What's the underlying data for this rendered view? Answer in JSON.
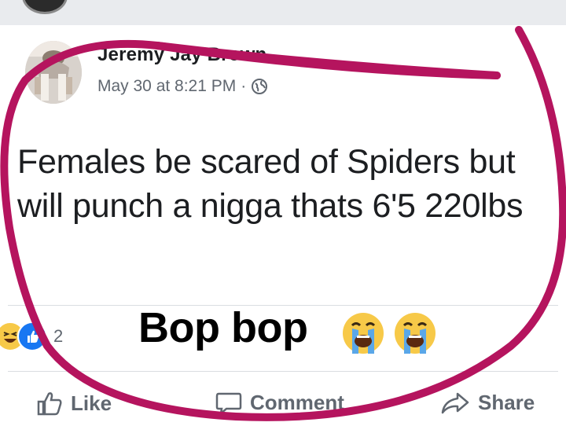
{
  "post": {
    "author": "Jeremy Jay Brown",
    "timestamp": "May 30 at 8:21 PM",
    "separator": "·",
    "privacy_icon": "globe-icon",
    "text": "Females be scared of Spiders but will punch a nigga thats 6'5 220lbs"
  },
  "reactions": {
    "icons": [
      "haha-reaction-icon",
      "like-reaction-icon"
    ],
    "count": "2"
  },
  "caption": {
    "text": "Bop bop",
    "emoji": [
      "loudly-crying-face",
      "loudly-crying-face"
    ]
  },
  "actions": {
    "like": "Like",
    "comment": "Comment",
    "share": "Share"
  },
  "colors": {
    "annotation_stroke": "#b5145e",
    "text_primary": "#1c1e21",
    "text_secondary": "#606770",
    "background": "#ffffff"
  }
}
